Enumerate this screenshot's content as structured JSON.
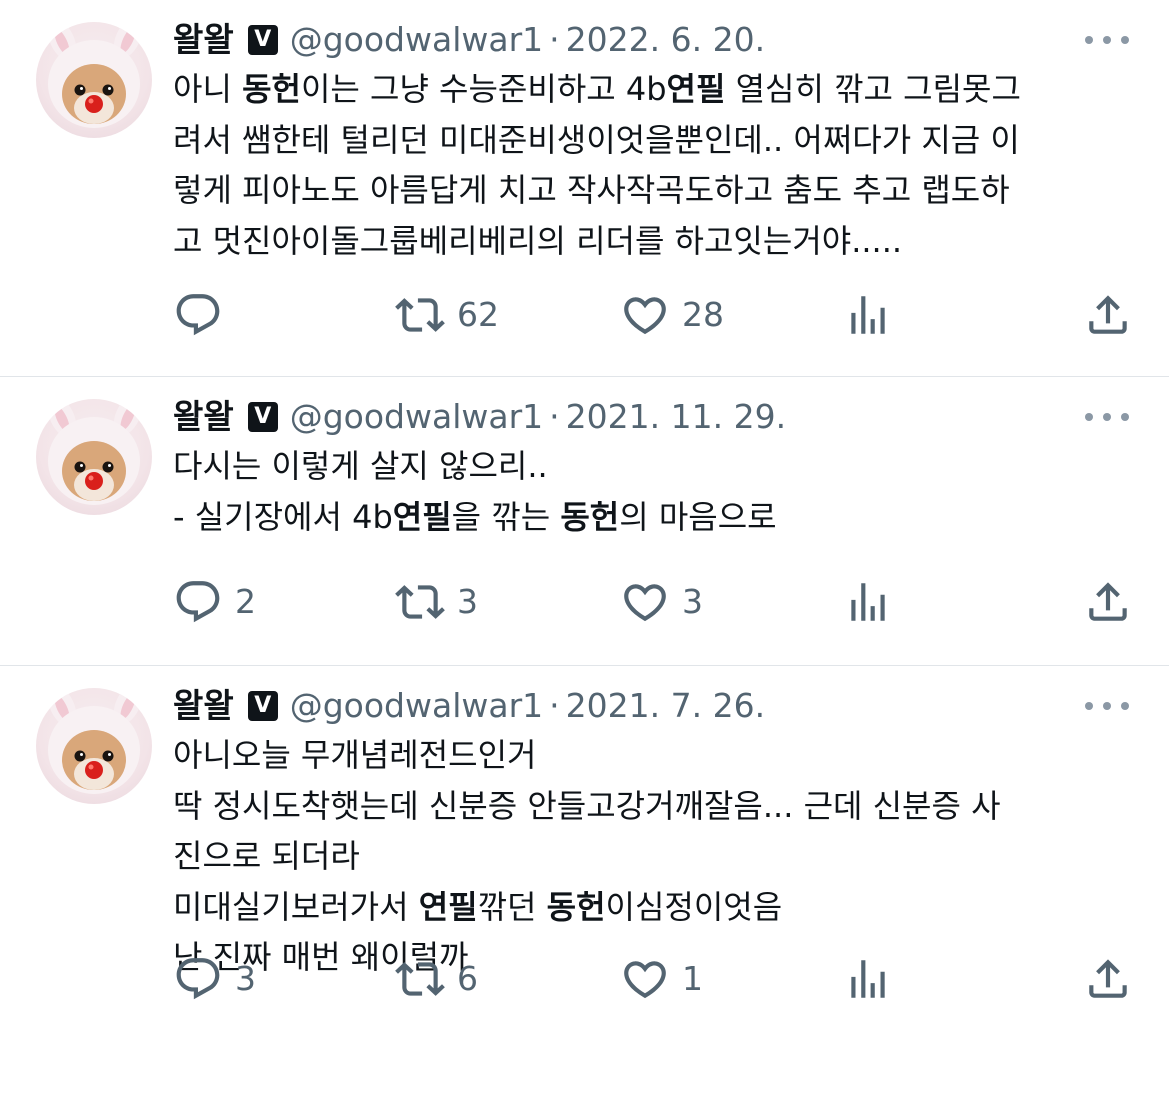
{
  "tweets": [
    {
      "author_name": "왈왈",
      "verified_mark": "V",
      "handle": "@goodwalwar1",
      "separator": "·",
      "date": "2022. 6. 20.",
      "lines": [
        [
          {
            "t": "아니 "
          },
          {
            "t": "동헌",
            "b": true
          },
          {
            "t": "이는 그냥 수능준비하고 4b"
          },
          {
            "t": "연필",
            "b": true
          },
          {
            "t": " 열심히 깎고 그림못그"
          }
        ],
        [
          {
            "t": "려서 쌤한테 털리던 미대준비생이엇을뿐인데.. 어쩌다가 지금 이"
          }
        ],
        [
          {
            "t": "렇게 피아노도 아름답게 치고 작사작곡도하고 춤도 추고 랩도하"
          }
        ],
        [
          {
            "t": "고 멋진아이돌그룹베리베리의 리더를 하고잇는거야....."
          }
        ]
      ],
      "replies": "",
      "retweets": "62",
      "likes": "28"
    },
    {
      "author_name": "왈왈",
      "verified_mark": "V",
      "handle": "@goodwalwar1",
      "separator": "·",
      "date": "2021. 11. 29.",
      "lines": [
        [
          {
            "t": "다시는 이렇게 살지 않으리.."
          }
        ],
        [
          {
            "t": " - 실기장에서 4b"
          },
          {
            "t": "연필",
            "b": true
          },
          {
            "t": "을 깎는 "
          },
          {
            "t": "동헌",
            "b": true
          },
          {
            "t": "의 마음으로"
          }
        ]
      ],
      "replies": "2",
      "retweets": "3",
      "likes": "3"
    },
    {
      "author_name": "왈왈",
      "verified_mark": "V",
      "handle": "@goodwalwar1",
      "separator": "·",
      "date": "2021. 7. 26.",
      "lines": [
        [
          {
            "t": "아니오늘 무개념레전드인거"
          }
        ],
        [
          {
            "t": "딱 정시도착햇는데 신분증 안들고강거깨잘음... 근데 신분증 사"
          }
        ],
        [
          {
            "t": "진으로 되더라"
          }
        ],
        [
          {
            "t": "미대실기보러가서 "
          },
          {
            "t": "연필",
            "b": true
          },
          {
            "t": "깎던 "
          },
          {
            "t": "동헌",
            "b": true
          },
          {
            "t": "이심정이엇음"
          }
        ],
        [
          {
            "t": "난 진짜 매번 왜이럴까"
          }
        ]
      ],
      "replies": "3",
      "retweets": "6",
      "likes": "1"
    }
  ],
  "icons": {
    "reply": "reply-icon",
    "retweet": "retweet-icon",
    "like": "like-icon",
    "views": "views-icon",
    "share": "share-icon",
    "more": "more-icon",
    "avatar": "dog-avatar"
  },
  "colors": {
    "text": "#0f1419",
    "secondary": "#536471",
    "divider": "#e1e5e9",
    "icon": "#536471"
  }
}
